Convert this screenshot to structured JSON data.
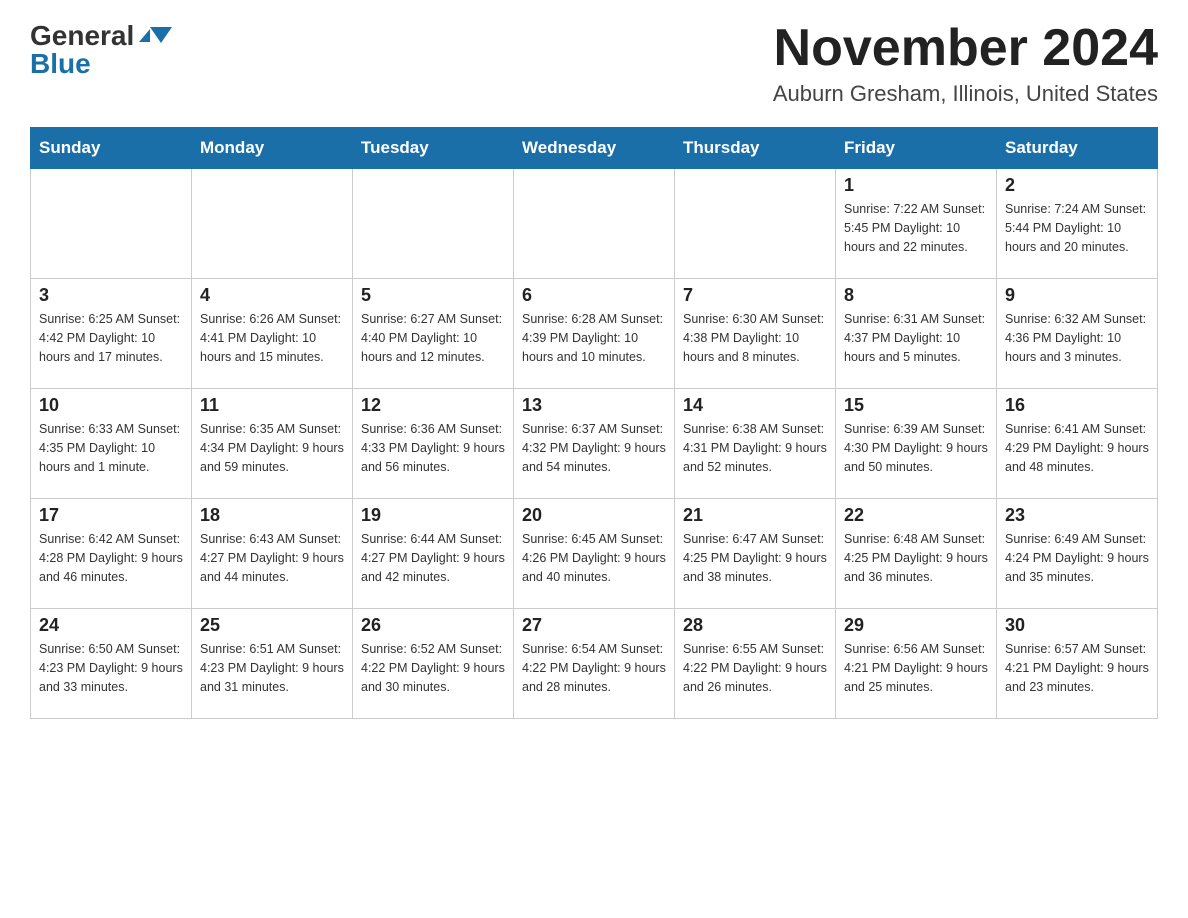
{
  "logo": {
    "line1": "General",
    "line2": "Blue"
  },
  "header": {
    "month_year": "November 2024",
    "location": "Auburn Gresham, Illinois, United States"
  },
  "weekdays": [
    "Sunday",
    "Monday",
    "Tuesday",
    "Wednesday",
    "Thursday",
    "Friday",
    "Saturday"
  ],
  "weeks": [
    [
      {
        "day": "",
        "info": ""
      },
      {
        "day": "",
        "info": ""
      },
      {
        "day": "",
        "info": ""
      },
      {
        "day": "",
        "info": ""
      },
      {
        "day": "",
        "info": ""
      },
      {
        "day": "1",
        "info": "Sunrise: 7:22 AM\nSunset: 5:45 PM\nDaylight: 10 hours and 22 minutes."
      },
      {
        "day": "2",
        "info": "Sunrise: 7:24 AM\nSunset: 5:44 PM\nDaylight: 10 hours and 20 minutes."
      }
    ],
    [
      {
        "day": "3",
        "info": "Sunrise: 6:25 AM\nSunset: 4:42 PM\nDaylight: 10 hours and 17 minutes."
      },
      {
        "day": "4",
        "info": "Sunrise: 6:26 AM\nSunset: 4:41 PM\nDaylight: 10 hours and 15 minutes."
      },
      {
        "day": "5",
        "info": "Sunrise: 6:27 AM\nSunset: 4:40 PM\nDaylight: 10 hours and 12 minutes."
      },
      {
        "day": "6",
        "info": "Sunrise: 6:28 AM\nSunset: 4:39 PM\nDaylight: 10 hours and 10 minutes."
      },
      {
        "day": "7",
        "info": "Sunrise: 6:30 AM\nSunset: 4:38 PM\nDaylight: 10 hours and 8 minutes."
      },
      {
        "day": "8",
        "info": "Sunrise: 6:31 AM\nSunset: 4:37 PM\nDaylight: 10 hours and 5 minutes."
      },
      {
        "day": "9",
        "info": "Sunrise: 6:32 AM\nSunset: 4:36 PM\nDaylight: 10 hours and 3 minutes."
      }
    ],
    [
      {
        "day": "10",
        "info": "Sunrise: 6:33 AM\nSunset: 4:35 PM\nDaylight: 10 hours and 1 minute."
      },
      {
        "day": "11",
        "info": "Sunrise: 6:35 AM\nSunset: 4:34 PM\nDaylight: 9 hours and 59 minutes."
      },
      {
        "day": "12",
        "info": "Sunrise: 6:36 AM\nSunset: 4:33 PM\nDaylight: 9 hours and 56 minutes."
      },
      {
        "day": "13",
        "info": "Sunrise: 6:37 AM\nSunset: 4:32 PM\nDaylight: 9 hours and 54 minutes."
      },
      {
        "day": "14",
        "info": "Sunrise: 6:38 AM\nSunset: 4:31 PM\nDaylight: 9 hours and 52 minutes."
      },
      {
        "day": "15",
        "info": "Sunrise: 6:39 AM\nSunset: 4:30 PM\nDaylight: 9 hours and 50 minutes."
      },
      {
        "day": "16",
        "info": "Sunrise: 6:41 AM\nSunset: 4:29 PM\nDaylight: 9 hours and 48 minutes."
      }
    ],
    [
      {
        "day": "17",
        "info": "Sunrise: 6:42 AM\nSunset: 4:28 PM\nDaylight: 9 hours and 46 minutes."
      },
      {
        "day": "18",
        "info": "Sunrise: 6:43 AM\nSunset: 4:27 PM\nDaylight: 9 hours and 44 minutes."
      },
      {
        "day": "19",
        "info": "Sunrise: 6:44 AM\nSunset: 4:27 PM\nDaylight: 9 hours and 42 minutes."
      },
      {
        "day": "20",
        "info": "Sunrise: 6:45 AM\nSunset: 4:26 PM\nDaylight: 9 hours and 40 minutes."
      },
      {
        "day": "21",
        "info": "Sunrise: 6:47 AM\nSunset: 4:25 PM\nDaylight: 9 hours and 38 minutes."
      },
      {
        "day": "22",
        "info": "Sunrise: 6:48 AM\nSunset: 4:25 PM\nDaylight: 9 hours and 36 minutes."
      },
      {
        "day": "23",
        "info": "Sunrise: 6:49 AM\nSunset: 4:24 PM\nDaylight: 9 hours and 35 minutes."
      }
    ],
    [
      {
        "day": "24",
        "info": "Sunrise: 6:50 AM\nSunset: 4:23 PM\nDaylight: 9 hours and 33 minutes."
      },
      {
        "day": "25",
        "info": "Sunrise: 6:51 AM\nSunset: 4:23 PM\nDaylight: 9 hours and 31 minutes."
      },
      {
        "day": "26",
        "info": "Sunrise: 6:52 AM\nSunset: 4:22 PM\nDaylight: 9 hours and 30 minutes."
      },
      {
        "day": "27",
        "info": "Sunrise: 6:54 AM\nSunset: 4:22 PM\nDaylight: 9 hours and 28 minutes."
      },
      {
        "day": "28",
        "info": "Sunrise: 6:55 AM\nSunset: 4:22 PM\nDaylight: 9 hours and 26 minutes."
      },
      {
        "day": "29",
        "info": "Sunrise: 6:56 AM\nSunset: 4:21 PM\nDaylight: 9 hours and 25 minutes."
      },
      {
        "day": "30",
        "info": "Sunrise: 6:57 AM\nSunset: 4:21 PM\nDaylight: 9 hours and 23 minutes."
      }
    ]
  ]
}
